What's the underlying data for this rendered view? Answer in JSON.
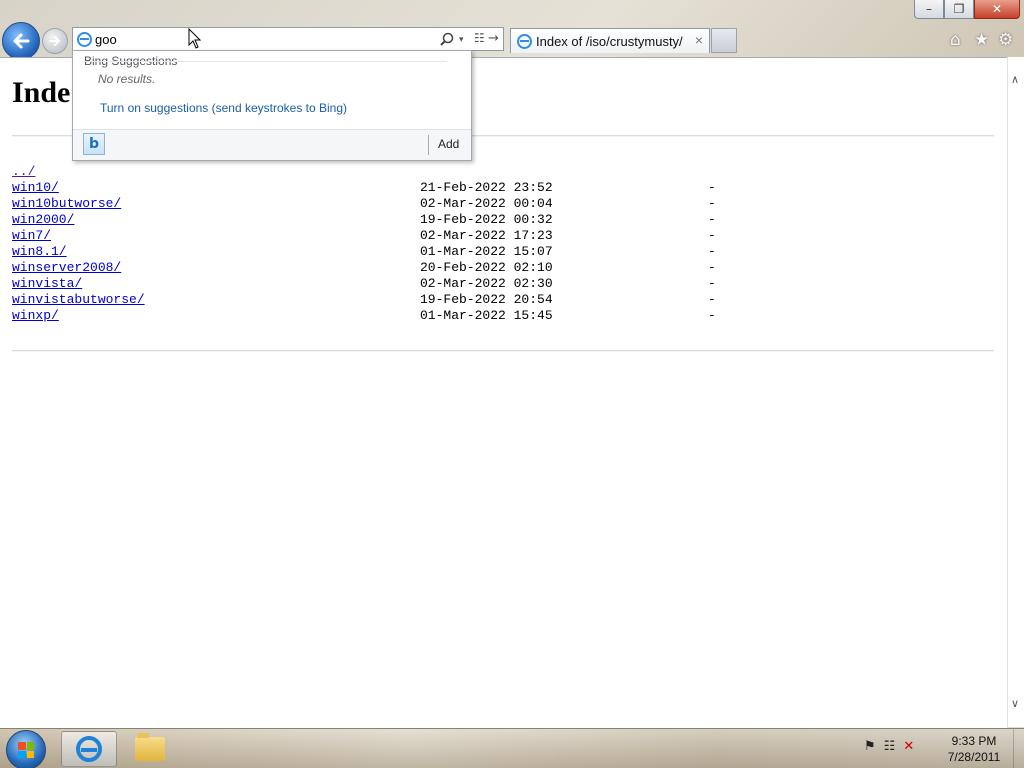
{
  "window": {
    "minimize_icon": "minimize-icon",
    "restore_icon": "restore-icon",
    "close_icon": "close-icon"
  },
  "address_bar": {
    "value": "goo",
    "search_icon": "magnifier-icon",
    "compat_icon": "compatibility-view-icon",
    "go_icon": "go-arrow-icon"
  },
  "tab": {
    "title": "Index of /iso/crustymusty/",
    "close": "×"
  },
  "toolbar": {
    "home_icon": "home-icon",
    "favorites_icon": "star-icon",
    "tools_icon": "gear-icon"
  },
  "suggestions": {
    "header": "Bing Suggestions",
    "no_results": "No results.",
    "turn_on": "Turn on suggestions (send keystrokes to Bing)",
    "add": "Add",
    "provider_icon": "bing-icon"
  },
  "page": {
    "title": "Inde",
    "parent_link": "../",
    "entries": [
      {
        "name": "win10/",
        "date": "21-Feb-2022 23:52",
        "size": "-"
      },
      {
        "name": "win10butworse/",
        "date": "02-Mar-2022 00:04",
        "size": "-"
      },
      {
        "name": "win2000/",
        "date": "19-Feb-2022 00:32",
        "size": "-"
      },
      {
        "name": "win7/",
        "date": "02-Mar-2022 17:23",
        "size": "-"
      },
      {
        "name": "win8.1/",
        "date": "01-Mar-2022 15:07",
        "size": "-"
      },
      {
        "name": "winserver2008/",
        "date": "20-Feb-2022 02:10",
        "size": "-"
      },
      {
        "name": "winvista/",
        "date": "02-Mar-2022 02:30",
        "size": "-"
      },
      {
        "name": "winvistabutworse/",
        "date": "19-Feb-2022 20:54",
        "size": "-"
      },
      {
        "name": "winxp/",
        "date": "01-Mar-2022 15:45",
        "size": "-"
      }
    ]
  },
  "taskbar": {
    "time": "9:33 PM",
    "date": "7/28/2011",
    "apps": [
      "internet-explorer",
      "windows-explorer"
    ]
  },
  "colors": {
    "link": "#0000cc",
    "visited_link": "#551a8b",
    "suggestion_link": "#1a5ea8"
  }
}
